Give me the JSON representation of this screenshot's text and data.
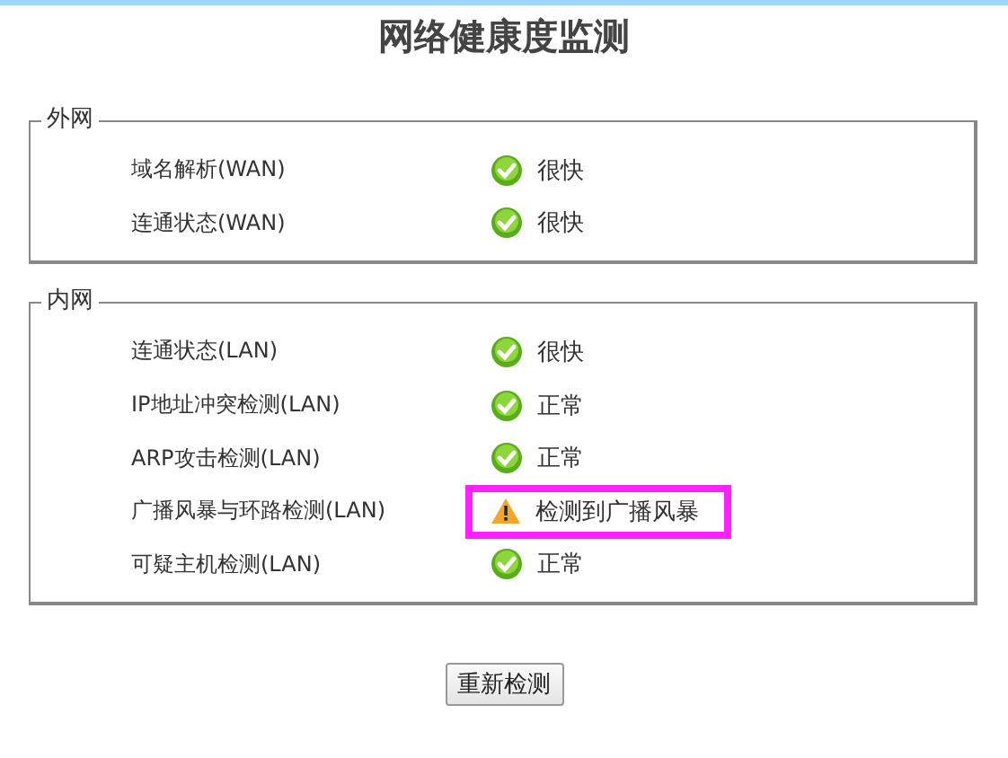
{
  "title": "网络健康度监测",
  "sections": [
    {
      "legend": "外网",
      "rows": [
        {
          "label": "域名解析(WAN)",
          "kind": "ok",
          "status": "很快",
          "highlighted": false
        },
        {
          "label": "连通状态(WAN)",
          "kind": "ok",
          "status": "很快",
          "highlighted": false
        }
      ]
    },
    {
      "legend": "内网",
      "rows": [
        {
          "label": "连通状态(LAN)",
          "kind": "ok",
          "status": "很快",
          "highlighted": false
        },
        {
          "label": "IP地址冲突检测(LAN)",
          "kind": "ok",
          "status": "正常",
          "highlighted": false
        },
        {
          "label": "ARP攻击检测(LAN)",
          "kind": "ok",
          "status": "正常",
          "highlighted": false
        },
        {
          "label": "广播风暴与环路检测(LAN)",
          "kind": "warning",
          "status": "检测到广播风暴",
          "highlighted": true
        },
        {
          "label": "可疑主机检测(LAN)",
          "kind": "ok",
          "status": "正常",
          "highlighted": false
        }
      ]
    }
  ],
  "button": "重新检测"
}
